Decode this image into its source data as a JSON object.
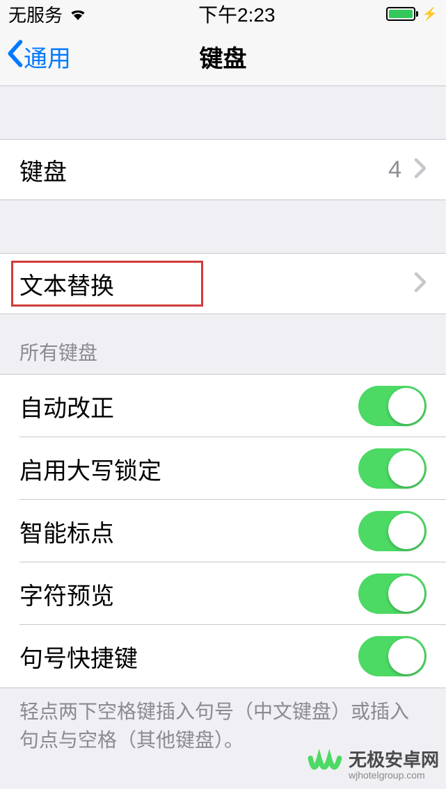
{
  "status": {
    "carrier": "无服务",
    "time": "下午2:23"
  },
  "nav": {
    "back_label": "通用",
    "title": "键盘"
  },
  "keyboards_row": {
    "label": "键盘",
    "count": "4"
  },
  "text_replacement": {
    "label": "文本替换"
  },
  "section_header": "所有键盘",
  "toggles": [
    {
      "label": "自动改正",
      "on": true
    },
    {
      "label": "启用大写锁定",
      "on": true
    },
    {
      "label": "智能标点",
      "on": true
    },
    {
      "label": "字符预览",
      "on": true
    },
    {
      "label": "句号快捷键",
      "on": true
    }
  ],
  "footer": "轻点两下空格键插入句号（中文键盘）或插入句点与空格（其他键盘）。",
  "watermark": {
    "cn": "无极安卓网",
    "en": "wjhotelgroup.com"
  }
}
